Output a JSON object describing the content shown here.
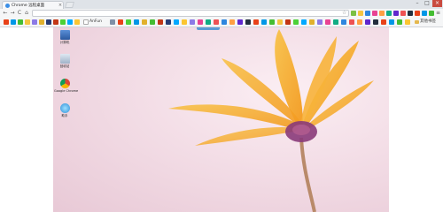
{
  "tab": {
    "title": "Chrome 远程桌面",
    "close_glyph": "×"
  },
  "window_controls": {
    "minimize": "–",
    "maximize": "□",
    "close": "×"
  },
  "toolbar": {
    "back": "←",
    "forward": "→",
    "reload": "C",
    "home": "⌂",
    "star": "☆",
    "menu": "≡"
  },
  "bookmarks_bar": {
    "visible_label": "AnFun",
    "other_bookmarks": "其他书签"
  },
  "desktop": {
    "icons": [
      {
        "name": "computer-icon",
        "label": "计算机"
      },
      {
        "name": "recycle-bin-icon",
        "label": "回收站"
      },
      {
        "name": "chrome-icon",
        "label": "Google Chrome"
      },
      {
        "name": "app-icon",
        "label": "助手"
      }
    ]
  },
  "colors": {
    "accent": "#5b9bd5",
    "flower_petal": "#f5a623",
    "flower_center": "#8a3a7a",
    "background_pink": "#f3dde6"
  }
}
